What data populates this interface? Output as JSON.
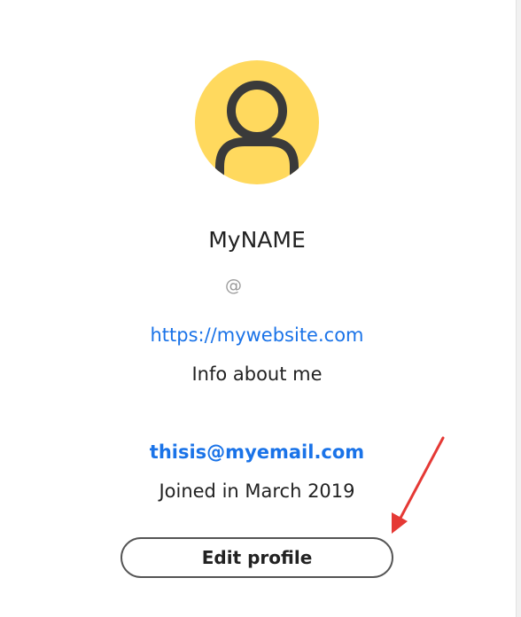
{
  "profile": {
    "avatar_icon": "user-silhouette-icon",
    "avatar_bg": "#ffd95e",
    "name": "MyNAME",
    "handle": "@",
    "website": "https://mywebsite.com",
    "info": "Info about me",
    "email": "thisis@myemail.com",
    "joined": "Joined in March 2019",
    "edit_button_label": "Edit profile"
  },
  "annotation": {
    "icon": "red-arrow-icon",
    "color": "#e53935"
  },
  "colors": {
    "link": "#1a73e8",
    "text": "#222222",
    "muted": "#9a9a9a"
  }
}
